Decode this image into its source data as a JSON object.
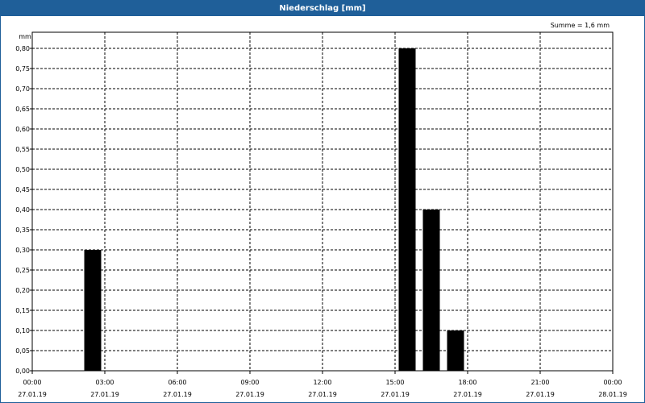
{
  "window": {
    "title": "Niederschlag [mm]"
  },
  "chart_data": {
    "type": "bar",
    "title": "Niederschlag [mm]",
    "ylabel": "mm",
    "ylim": [
      0,
      0.8
    ],
    "yticks": [
      "0,00",
      "0,05",
      "0,10",
      "0,15",
      "0,20",
      "0,25",
      "0,30",
      "0,35",
      "0,40",
      "0,45",
      "0,50",
      "0,55",
      "0,60",
      "0,65",
      "0,70",
      "0,75",
      "0,80"
    ],
    "xlim_hours": [
      0,
      24
    ],
    "xticks": [
      {
        "h": 0,
        "time": "00:00",
        "date": "27.01.19"
      },
      {
        "h": 3,
        "time": "03:00",
        "date": "27.01.19"
      },
      {
        "h": 6,
        "time": "06:00",
        "date": "27.01.19"
      },
      {
        "h": 9,
        "time": "09:00",
        "date": "27.01.19"
      },
      {
        "h": 12,
        "time": "12:00",
        "date": "27.01.19"
      },
      {
        "h": 15,
        "time": "15:00",
        "date": "27.01.19"
      },
      {
        "h": 18,
        "time": "18:00",
        "date": "27.01.19"
      },
      {
        "h": 21,
        "time": "21:00",
        "date": "27.01.19"
      },
      {
        "h": 24,
        "time": "00:00",
        "date": "28.01.19"
      }
    ],
    "bars": [
      {
        "h": 2.5,
        "value": 0.3
      },
      {
        "h": 15.5,
        "value": 0.8
      },
      {
        "h": 16.5,
        "value": 0.4
      },
      {
        "h": 17.5,
        "value": 0.1
      }
    ],
    "grid": true,
    "annotation": "Summe = 1,6 mm",
    "bar_color": "#000000"
  }
}
